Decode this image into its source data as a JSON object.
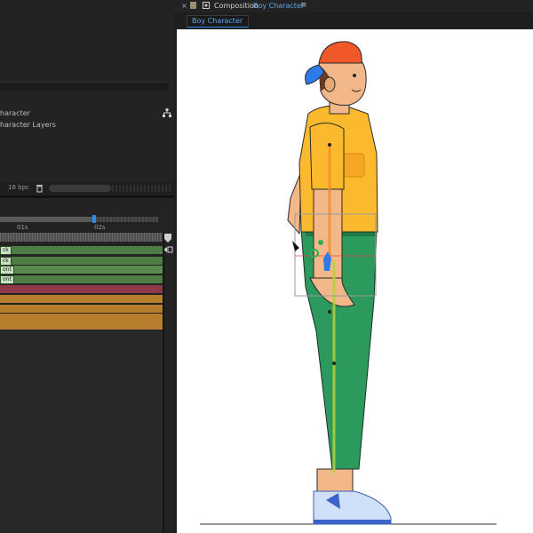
{
  "project_panel": {
    "items": [
      {
        "label": "haracter"
      },
      {
        "label": "haracter Layers"
      }
    ],
    "bpc_label": "16 bpc"
  },
  "timeline": {
    "ticks": [
      "01s",
      "02s"
    ],
    "layers": [
      {
        "label": "ck",
        "color": "#4f7b45"
      },
      {
        "label": "ck",
        "color": "#4f7b45"
      },
      {
        "label": "ont",
        "color": "#5a8a50"
      },
      {
        "label": "ont",
        "color": "#4f7b45"
      },
      {
        "label": "",
        "color": "#8f3a48"
      },
      {
        "label": "",
        "color": "#b57d2c"
      },
      {
        "label": "",
        "color": "#b57d2c"
      },
      {
        "label": "",
        "color": "#b57d2c"
      },
      {
        "label": "",
        "color": "#b57d2c"
      }
    ]
  },
  "composition": {
    "title_label": "Composition",
    "title_name": "Boy Character",
    "tab_label": "Boy Character",
    "menu_icon": "hamburger-icon"
  },
  "colors": {
    "accent_blue": "#2d8ceb",
    "shirt": "#fbb92d",
    "pants": "#2c9a5c",
    "skin": "#f3b889",
    "cap": "#f0582a"
  }
}
